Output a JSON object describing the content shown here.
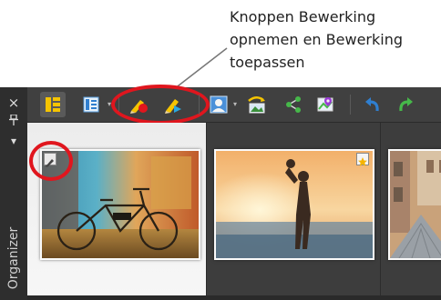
{
  "callout": {
    "lines": [
      "Knoppen Bewerking",
      "opnemen en Bewerking",
      "toepassen"
    ]
  },
  "sidebar": {
    "close_glyph": "×",
    "pin_glyph": "ᵽ",
    "menu_glyph": "▾",
    "label": "Organizer"
  },
  "toolbar": {
    "buttons": [
      {
        "name": "thumbnail-view-icon",
        "active": true
      },
      {
        "name": "details-view-icon",
        "active": false
      },
      {
        "name": "record-edits-icon",
        "active": false
      },
      {
        "name": "apply-edits-icon",
        "active": false
      },
      {
        "name": "user-profile-icon",
        "active": false
      },
      {
        "name": "photo-export-icon",
        "active": false
      },
      {
        "name": "share-icon",
        "active": false
      },
      {
        "name": "map-location-icon",
        "active": false
      },
      {
        "name": "rotate-left-icon",
        "active": false
      },
      {
        "name": "rotate-right-icon",
        "active": false
      }
    ]
  },
  "colors": {
    "highlight_red": "#e0161e",
    "yellow_accent": "#f5c400",
    "panel_dark": "#3a3a3a"
  },
  "thumbnails": [
    {
      "name": "bicycle-photo",
      "selected": true,
      "badge": "edited-badge"
    },
    {
      "name": "silhouette-beach-photo",
      "selected": false,
      "badge": "star-rating-badge"
    },
    {
      "name": "street-photo",
      "selected": false,
      "badge": null
    }
  ]
}
